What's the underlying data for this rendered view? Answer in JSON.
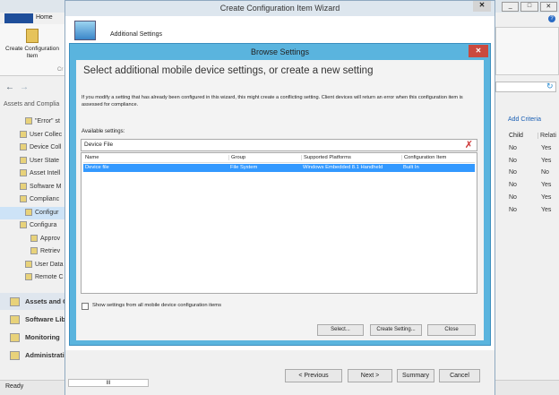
{
  "console": {
    "home_tab": "Home",
    "create_button": "Create Configuration Item",
    "ribbon_group": "Cr",
    "breadcrumb": "Assets and Complia",
    "nav_items": [
      "\"Error\" st",
      "User Collec",
      "Device Coll",
      "User State",
      "Asset Intell",
      "Software M",
      "Complianc",
      "Configur",
      "Configura",
      "Approv",
      "Retriev",
      "User Data",
      "Remote C"
    ],
    "workspaces": [
      "Assets and C",
      "Software Lib",
      "Monitoring",
      "Administratio"
    ],
    "status": "Ready",
    "add_criteria": "Add Criteria",
    "columns": [
      "Child",
      "Relati"
    ],
    "rows": [
      [
        "No",
        "Yes"
      ],
      [
        "No",
        "Yes"
      ],
      [
        "No",
        "No"
      ],
      [
        "No",
        "Yes"
      ],
      [
        "No",
        "Yes"
      ],
      [
        "No",
        "Yes"
      ]
    ],
    "scroll_thumb": "III"
  },
  "wizard": {
    "title": "Create Configuration Item Wizard",
    "page": "Additional Settings",
    "buttons": {
      "previous": "< Previous",
      "next": "Next >",
      "summary": "Summary",
      "cancel": "Cancel"
    }
  },
  "dialog": {
    "title": "Browse Settings",
    "heading": "Select additional mobile device settings, or create a new setting",
    "description": "If you modify a setting that has already been configured in this wizard, this might create a conflicting setting.  Client devices will return an error when this configuration item is assessed for compliance.",
    "available_label": "Available settings:",
    "search_value": "Device File",
    "columns": [
      "Name",
      "Group",
      "Supported Platforms",
      "Configuration Item"
    ],
    "rows": [
      [
        "Device file",
        "File System",
        "Windows Embedded 8.1 Handheld",
        "Built In"
      ]
    ],
    "checkbox_label": "Show settings from all mobile device configuration items",
    "buttons": {
      "select": "Select...",
      "create": "Create Setting...",
      "close": "Close"
    }
  },
  "colors": {
    "accent": "#3399ff",
    "dialog_border": "#5ab4de",
    "close": "#c94a3f"
  }
}
